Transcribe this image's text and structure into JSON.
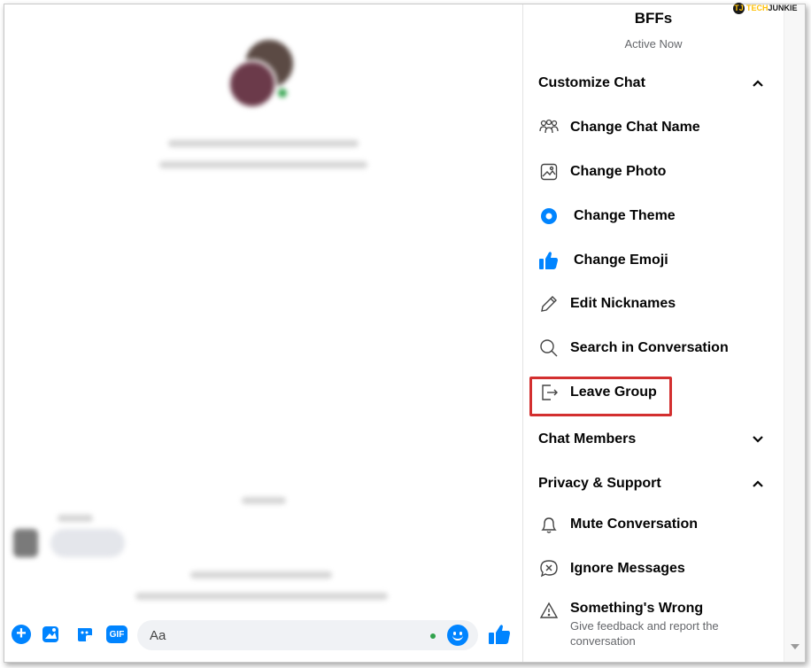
{
  "chat": {
    "input_placeholder": "Aa"
  },
  "info": {
    "title": "BFFs",
    "status": "Active Now",
    "customize_section": "Customize Chat",
    "items": [
      {
        "label": "Change Chat Name",
        "icon": "people-icon"
      },
      {
        "label": "Change Photo",
        "icon": "image-icon"
      },
      {
        "label": "Change Theme",
        "icon": "theme-icon"
      },
      {
        "label": "Change Emoji",
        "icon": "thumbs-up-icon"
      },
      {
        "label": "Edit Nicknames",
        "icon": "pencil-icon"
      },
      {
        "label": "Search in Conversation",
        "icon": "search-icon"
      },
      {
        "label": "Leave Group",
        "icon": "leave-icon"
      }
    ],
    "members_section": "Chat Members",
    "privacy_section": "Privacy & Support",
    "privacy_items": [
      {
        "label": "Mute Conversation",
        "icon": "bell-icon"
      },
      {
        "label": "Ignore Messages",
        "icon": "ignore-icon"
      },
      {
        "label": "Something's Wrong",
        "icon": "warning-icon",
        "sub": "Give feedback and report the conversation"
      }
    ]
  },
  "watermark": {
    "mark": "TJ",
    "part1": "TECH",
    "part2": "JUNKIE",
    "mark_color": "#ffc107"
  },
  "colors": {
    "accent": "#0084ff",
    "highlight": "#d32f2f",
    "online": "#31a24c"
  }
}
